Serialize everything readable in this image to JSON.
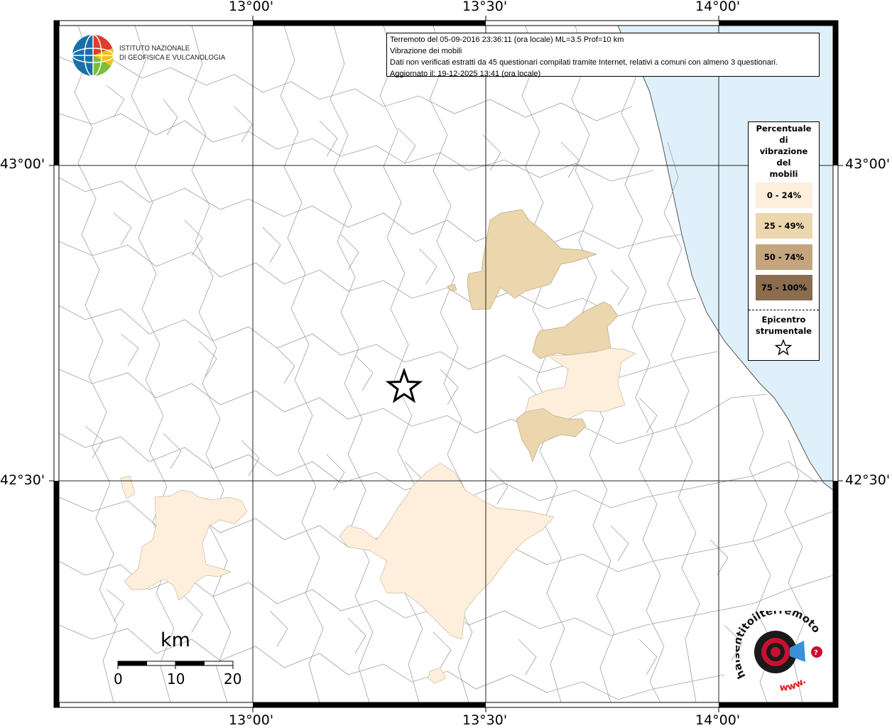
{
  "info": {
    "line1": "Terremoto del 05-09-2016 23:36:11 (ora locale) ML=3.5 Prof=10 km",
    "line2": "Vibrazione dei mobili",
    "line3": "Dati non verificati estratti da 45 questionari compilati tramite Internet, relativi a comuni con almeno 3 questionari.",
    "line4": "Aggiornato il: 19-12-2025 13:41 (ora locale)"
  },
  "logo": {
    "line1": "ISTITUTO NAZIONALE",
    "line2": "DI GEOFISICA E VULCANOLOGIA"
  },
  "axes": {
    "top": [
      "13°00'",
      "13°30'",
      "14°00'"
    ],
    "bottom": [
      "13°00'",
      "13°30'",
      "14°00'"
    ],
    "left": [
      "43°00'",
      "42°30'"
    ],
    "right": [
      "43°00'",
      "42°30'"
    ]
  },
  "legend": {
    "title_lines": [
      "Percentuale",
      "di",
      "vibrazione",
      "del",
      "mobili"
    ],
    "items": [
      {
        "label": "0 - 24%",
        "color": "#fdefdc"
      },
      {
        "label": "25 - 49%",
        "color": "#ebd6ad"
      },
      {
        "label": "50 - 74%",
        "color": "#c4a57e"
      },
      {
        "label": "75 - 100%",
        "color": "#8b6c4e"
      }
    ],
    "epicentro_lines": [
      "Epicentro",
      "strumentale"
    ]
  },
  "scale": {
    "unit": "km",
    "ticks": [
      "0",
      "10",
      "20"
    ]
  },
  "badge": {
    "text": "haisentitoilterremoto.it",
    "url": "www."
  },
  "colors": {
    "sea": "#dff0fb",
    "border": "#9c9c9c",
    "class1": "#fdefdc",
    "class2": "#ebd6ad"
  }
}
